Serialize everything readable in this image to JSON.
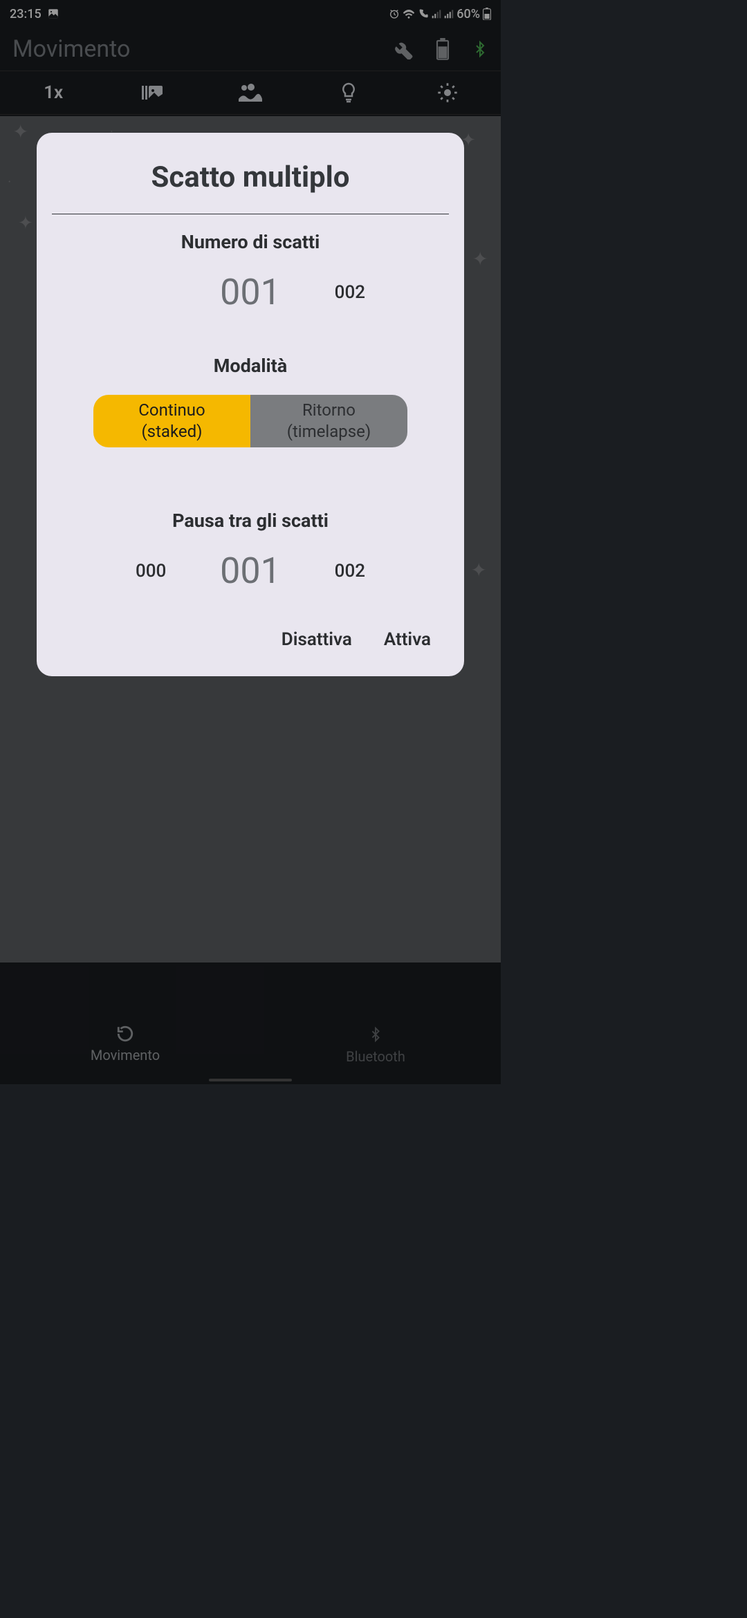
{
  "status": {
    "time": "23:15",
    "battery": "60%"
  },
  "header": {
    "title": "Movimento"
  },
  "toolbar": {
    "zoom": "1x"
  },
  "dialog": {
    "title": "Scatto multiplo",
    "shots": {
      "label": "Numero di scatti",
      "prev": "",
      "current": "001",
      "next": "002"
    },
    "mode": {
      "label": "Modalità",
      "option_a_line1": "Continuo",
      "option_a_line2": "(staked)",
      "option_b_line1": "Ritorno",
      "option_b_line2": "(timelapse)",
      "selected": "a"
    },
    "pause": {
      "label": "Pausa tra gli scatti",
      "prev": "000",
      "current": "001",
      "next": "002"
    },
    "actions": {
      "deactivate": "Disattiva",
      "activate": "Attiva"
    }
  },
  "bottom_nav": {
    "left": "Movimento",
    "right": "Bluetooth"
  }
}
